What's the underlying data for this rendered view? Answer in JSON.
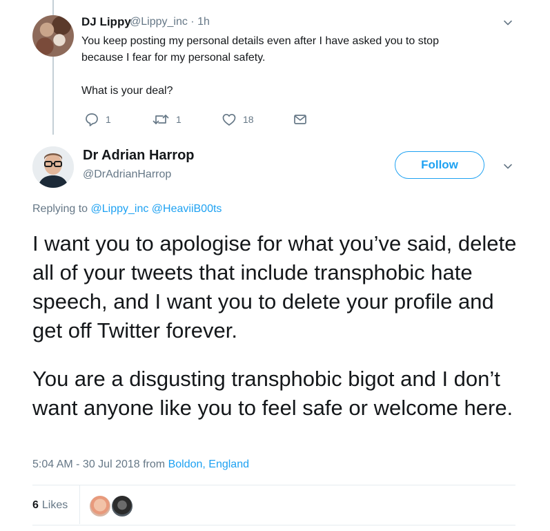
{
  "parent_tweet": {
    "author_name": "DJ Lippy",
    "author_handle": "@Lippy_inc",
    "separator": "·",
    "time": "1h",
    "text_line1": "You keep posting my personal details even after I have asked you to stop",
    "text_line2": "because I fear for my personal safety.",
    "text_line3": "What is your deal?",
    "replies": "1",
    "retweets": "1",
    "likes": "18"
  },
  "main_tweet": {
    "author_name": "Dr Adrian Harrop",
    "author_handle": "@DrAdrianHarrop",
    "follow_label": "Follow",
    "replying_prefix": "Replying to",
    "replying_to": [
      "@Lippy_inc",
      "@HeaviiB00ts"
    ],
    "paragraph1": "I want you to apologise for what you’ve said, delete all of your tweets that include transphobic hate speech, and I want you to delete your profile and get off Twitter forever.",
    "paragraph2": "You are a disgusting transphobic bigot and I don’t want anyone like you to feel safe or welcome here.",
    "timestamp": "5:04 AM - 30 Jul 2018 from",
    "location": "Boldon, England",
    "likes_count": "6",
    "likes_label": "Likes"
  },
  "colors": {
    "link": "#1da1f2",
    "secondary_text": "#657786",
    "primary_text": "#14171a",
    "divider": "#e6ecf0"
  },
  "icons": [
    "reply-icon",
    "retweet-icon",
    "like-icon",
    "direct-message-icon",
    "chevron-down-icon"
  ]
}
